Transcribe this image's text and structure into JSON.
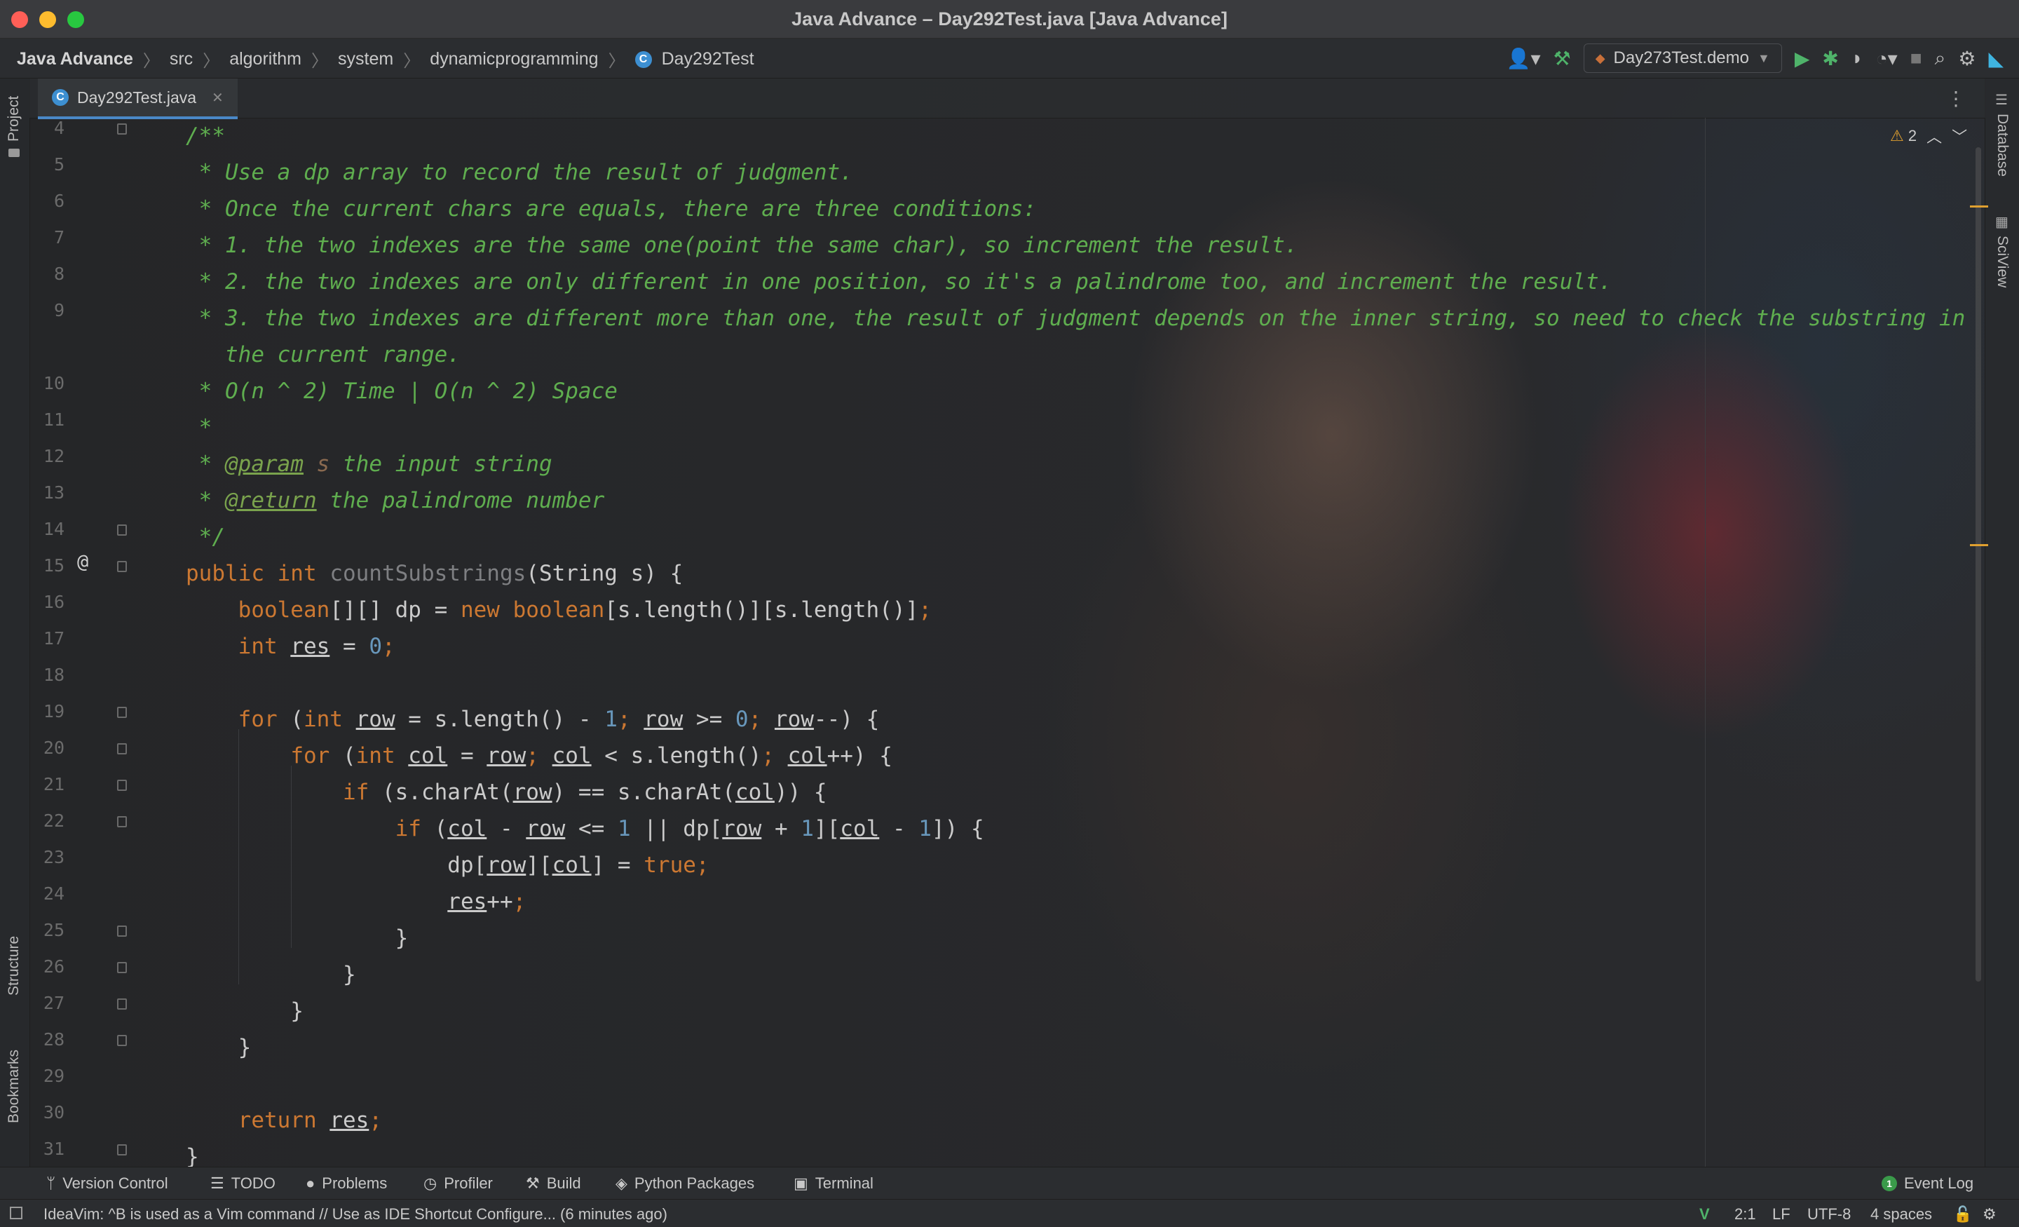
{
  "window": {
    "title": "Java Advance – Day292Test.java [Java Advance]"
  },
  "breadcrumb": {
    "items": [
      "Java Advance",
      "src",
      "algorithm",
      "system",
      "dynamicprogramming",
      "Day292Test"
    ]
  },
  "toolbar": {
    "run_config": "Day273Test.demo"
  },
  "tab": {
    "label": "Day292Test.java"
  },
  "side": {
    "left_top": "Project",
    "left_structure": "Structure",
    "left_bookmarks": "Bookmarks",
    "right_database": "Database",
    "right_sciview": "SciView"
  },
  "editor": {
    "warnings_count": "2",
    "line_numbers": [
      "4",
      "5",
      "6",
      "7",
      "8",
      "9",
      "",
      "10",
      "11",
      "12",
      "13",
      "14",
      "15",
      "16",
      "17",
      "18",
      "19",
      "20",
      "21",
      "22",
      "23",
      "24",
      "25",
      "26",
      "27",
      "28",
      "29",
      "30",
      "31"
    ]
  },
  "bottom_tools": {
    "version_control": "Version Control",
    "todo": "TODO",
    "problems": "Problems",
    "profiler": "Profiler",
    "build": "Build",
    "python_packages": "Python Packages",
    "terminal": "Terminal",
    "event_log": "Event Log",
    "event_log_count": "1"
  },
  "status": {
    "message": "IdeaVim: ^B is used as a Vim command // Use as IDE Shortcut   Configure... (6 minutes ago)",
    "position": "2:1",
    "line_ending": "LF",
    "encoding": "UTF-8",
    "indent": "4 spaces"
  },
  "colors": {
    "comment": "#5fae4f",
    "keyword": "#cc7832",
    "number": "#6897bb",
    "accent": "#4a88c7",
    "warning": "#e0a030"
  }
}
